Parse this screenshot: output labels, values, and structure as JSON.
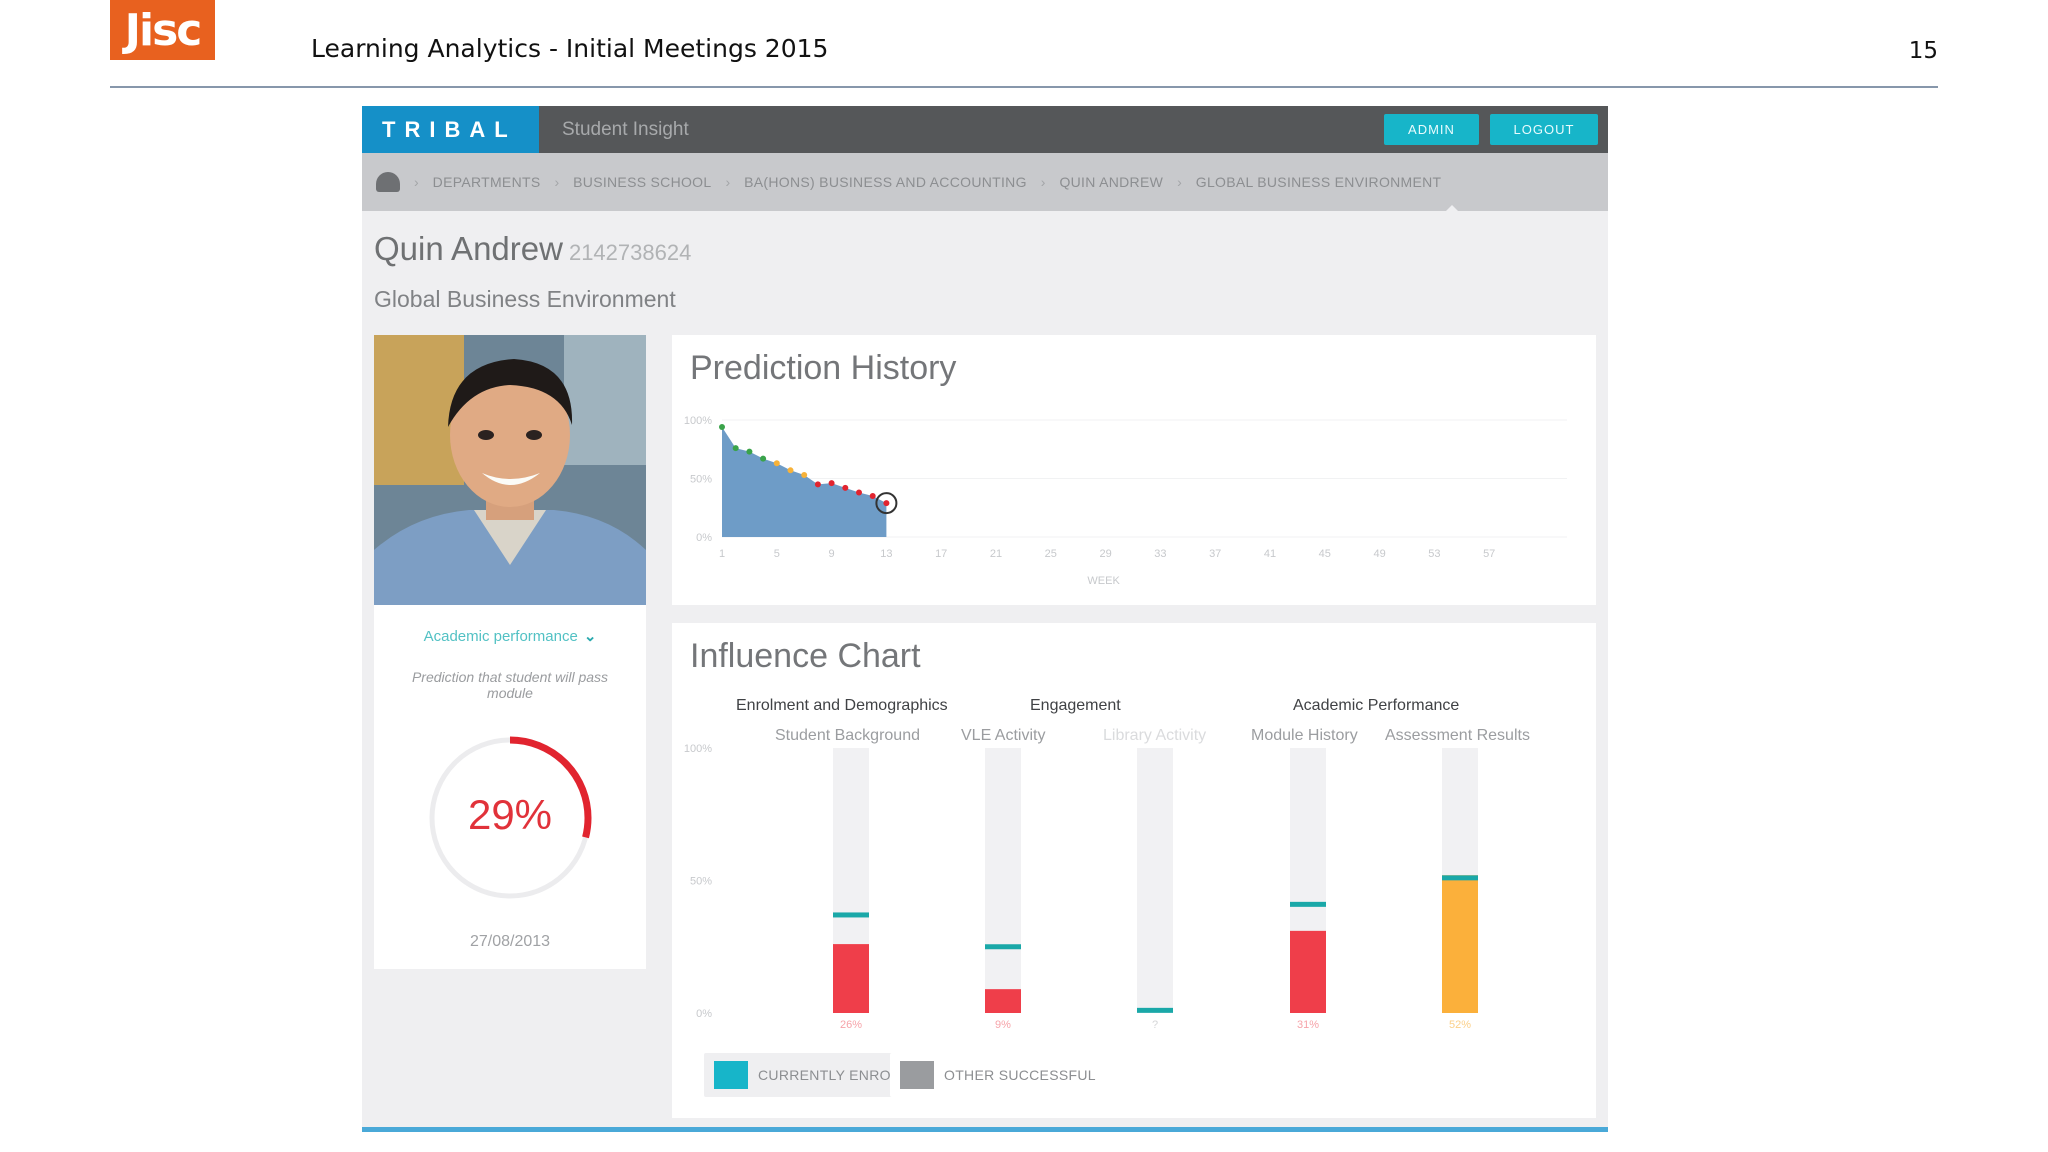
{
  "slide": {
    "logo": "Jisc",
    "title": "Learning Analytics - Initial Meetings 2015",
    "page_number": "15"
  },
  "app": {
    "brand": "TRIBAL",
    "product": "Student Insight",
    "buttons": {
      "admin": "ADMIN",
      "logout": "LOGOUT"
    },
    "breadcrumbs": [
      "DEPARTMENTS",
      "BUSINESS SCHOOL",
      "BA(HONS) BUSINESS AND ACCOUNTING",
      "QUIN ANDREW",
      "GLOBAL BUSINESS ENVIRONMENT"
    ],
    "student": {
      "name": "Quin Andrew",
      "id": "2142738624",
      "module": "Global Business Environment"
    },
    "left_card": {
      "selector": "Academic performance",
      "description": "Prediction that student will pass module",
      "prediction": "29%",
      "prediction_value": 29,
      "date": "27/08/2013"
    },
    "prediction_history": {
      "title": "Prediction History"
    },
    "influence": {
      "title": "Influence Chart",
      "groups": [
        "Enrolment and Demographics",
        "Engagement",
        "Academic Performance"
      ],
      "legend": {
        "current": "CURRENTLY ENROLLED",
        "other": "OTHER SUCCESSFUL"
      }
    },
    "colors": {
      "teal": "#17b5c9",
      "red": "#ef3e4a",
      "orange": "#fbb03b",
      "brand_blue": "#1590c8"
    }
  },
  "chart_data": [
    {
      "type": "area",
      "title": "Prediction History",
      "xlabel": "WEEK",
      "ylabel": "",
      "x_ticks": [
        "1",
        "5",
        "9",
        "13",
        "17",
        "21",
        "25",
        "29",
        "33",
        "37",
        "41",
        "45",
        "49",
        "53",
        "57"
      ],
      "y_ticks": [
        "100%",
        "50%",
        "0%"
      ],
      "ylim": [
        0,
        100
      ],
      "series": [
        {
          "x": [
            1,
            2,
            3,
            4,
            5,
            6,
            7,
            8,
            9,
            10,
            11,
            12,
            13
          ],
          "values": [
            94,
            76,
            73,
            67,
            63,
            57,
            53,
            45,
            46,
            42,
            38,
            35,
            29
          ]
        }
      ]
    },
    {
      "type": "bar",
      "title": "Influence Chart",
      "categories": [
        "Student Background",
        "VLE Activity",
        "Library Activity",
        "Module History",
        "Assessment Results"
      ],
      "y_ticks": [
        "100%",
        "50%",
        "0%"
      ],
      "ylim": [
        0,
        100
      ],
      "series": [
        {
          "name": "CURRENTLY ENROLLED",
          "values": [
            26,
            9,
            0,
            31,
            52
          ]
        },
        {
          "name": "OTHER SUCCESSFUL",
          "values": [
            37,
            25,
            1,
            41,
            51
          ]
        }
      ],
      "data_labels": [
        "26%",
        "9%",
        "?",
        "31%",
        "52%"
      ]
    }
  ]
}
